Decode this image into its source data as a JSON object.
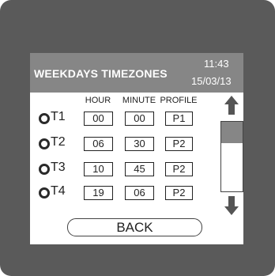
{
  "header": {
    "title": "WEEKDAYS TIMEZONES",
    "time": "11:43",
    "date": "15/03/13"
  },
  "columns": {
    "hour": "HOUR",
    "minute": "MINUTE",
    "profile": "PROFILE"
  },
  "rows": [
    {
      "label": "T1",
      "hour": "00",
      "minute": "00",
      "profile": "P1"
    },
    {
      "label": "T2",
      "hour": "06",
      "minute": "30",
      "profile": "P2"
    },
    {
      "label": "T3",
      "hour": "10",
      "minute": "45",
      "profile": "P2"
    },
    {
      "label": "T4",
      "hour": "19",
      "minute": "06",
      "profile": "P2"
    }
  ],
  "footer": {
    "back_label": "BACK"
  },
  "scrollbar": {
    "position_fraction": 0.0
  },
  "icons": {
    "scroll_up": "arrow-up-icon",
    "scroll_down": "arrow-down-icon",
    "row_select": "radio-icon"
  },
  "colors": {
    "bezel": "#5a5a5a",
    "header": "#868686",
    "screen": "#ffffff"
  }
}
